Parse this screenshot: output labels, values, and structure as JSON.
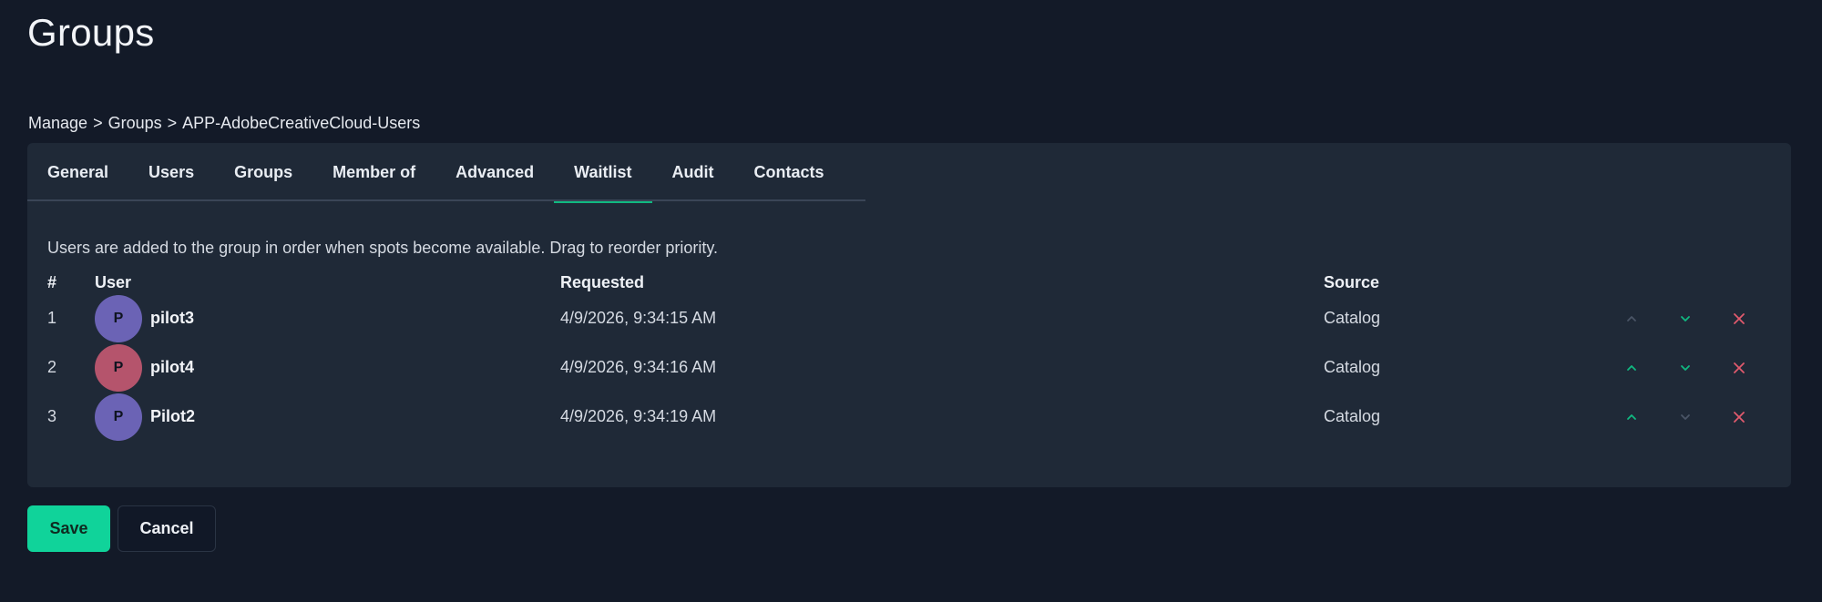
{
  "page": {
    "title": "Groups"
  },
  "breadcrumb": [
    "Manage",
    "Groups",
    "APP-AdobeCreativeCloud-Users"
  ],
  "tabs": [
    {
      "label": "General",
      "active": false
    },
    {
      "label": "Users",
      "active": false
    },
    {
      "label": "Groups",
      "active": false
    },
    {
      "label": "Member of",
      "active": false
    },
    {
      "label": "Advanced",
      "active": false
    },
    {
      "label": "Waitlist",
      "active": true
    },
    {
      "label": "Audit",
      "active": false
    },
    {
      "label": "Contacts",
      "active": false
    }
  ],
  "hint": "Users are added to the group in order when spots become available. Drag to reorder priority.",
  "table": {
    "headers": {
      "num": "#",
      "user": "User",
      "requested": "Requested",
      "source": "Source"
    },
    "rows": [
      {
        "num": "1",
        "initial": "P",
        "user": "pilot3",
        "requested": "4/9/2026, 9:34:15 AM",
        "source": "Catalog",
        "avatar_color": "#6b63b5",
        "up_enabled": false,
        "down_enabled": true
      },
      {
        "num": "2",
        "initial": "P",
        "user": "pilot4",
        "requested": "4/9/2026, 9:34:16 AM",
        "source": "Catalog",
        "avatar_color": "#b5546c",
        "up_enabled": true,
        "down_enabled": true
      },
      {
        "num": "3",
        "initial": "P",
        "user": "Pilot2",
        "requested": "4/9/2026, 9:34:19 AM",
        "source": "Catalog",
        "avatar_color": "#6b63b5",
        "up_enabled": true,
        "down_enabled": false
      }
    ]
  },
  "icons": {
    "up": "chevron-up-icon",
    "down": "chevron-down-icon",
    "remove": "close-icon"
  },
  "colors": {
    "accent": "#10b981",
    "save_bg": "#10d39a",
    "danger": "#e05a6d",
    "disabled": "#4a5566"
  },
  "actions": {
    "save_label": "Save",
    "cancel_label": "Cancel"
  }
}
